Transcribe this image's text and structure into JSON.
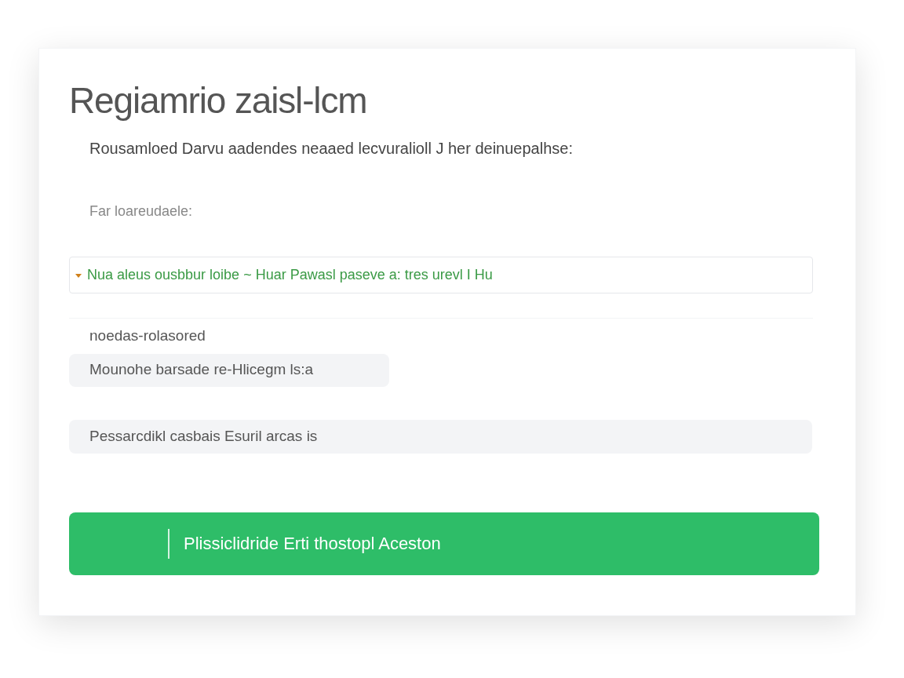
{
  "title": "Regiamrio zaisl-lcm",
  "subtitle": "Rousamloed Darvu aadendes neaaed lecvuralioll J her deinuepalhse:",
  "field_label": "Far loareudaele:",
  "status_field": {
    "value": "Nua aleus ousbbur loibe ~ Huar Pawasl paseve a: tres urevl I Hu"
  },
  "section_label": "noedas-rolasored",
  "chip": "Mounohe barsade re-Hlicegm ls:a",
  "gray_field": {
    "value": "Pessarcdikl casbais Esuril arcas is"
  },
  "button": "Plissiclidride Erti thostopl Aceston"
}
